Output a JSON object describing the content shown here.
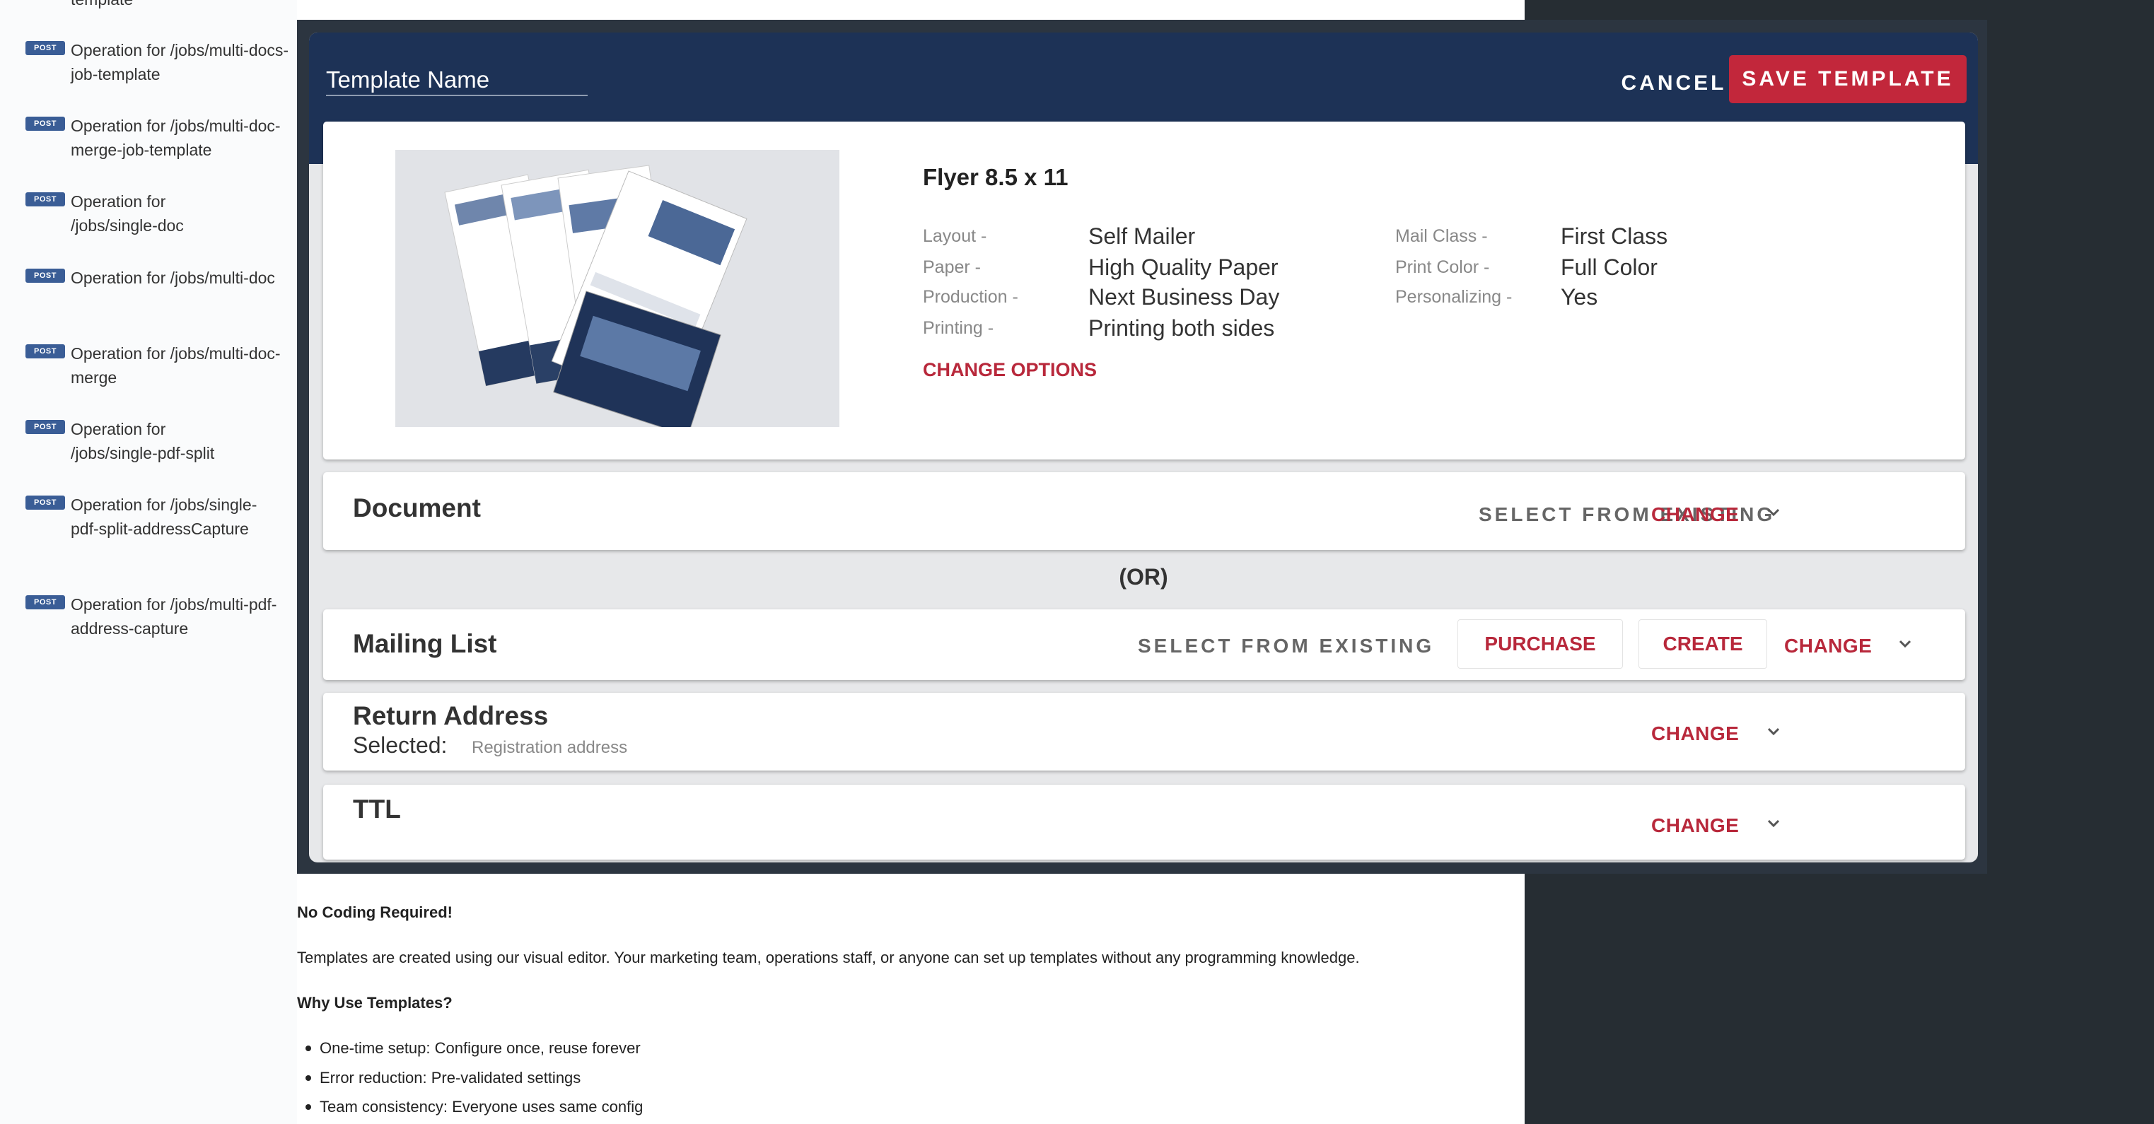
{
  "sidebar": {
    "cut_label": "template",
    "items": [
      {
        "badge": "POST",
        "label": "Operation for /jobs/multi-docs-job-template"
      },
      {
        "badge": "POST",
        "label": "Operation for /jobs/multi-doc-merge-job-template"
      },
      {
        "badge": "POST",
        "label": "Operation for /jobs/single-doc"
      },
      {
        "badge": "POST",
        "label": "Operation for /jobs/multi-doc"
      },
      {
        "badge": "POST",
        "label": "Operation for /jobs/multi-doc-merge"
      },
      {
        "badge": "POST",
        "label": "Operation for /jobs/single-pdf-split"
      },
      {
        "badge": "POST",
        "label": "Operation for /jobs/single-pdf-split-addressCapture"
      },
      {
        "badge": "POST",
        "label": "Operation for /jobs/multi-pdf-address-capture"
      }
    ]
  },
  "modal": {
    "template_name_placeholder": "Template Name",
    "cancel_label": "CANCEL",
    "save_label": "SAVE TEMPLATE",
    "product": {
      "title": "Flyer 8.5 x 11",
      "options_left": [
        {
          "label": "Layout -",
          "value": "Self Mailer"
        },
        {
          "label": "Paper -",
          "value": "High Quality Paper"
        },
        {
          "label": "Production -",
          "value": "Next Business Day"
        },
        {
          "label": "Printing -",
          "value": "Printing both sides"
        }
      ],
      "options_right": [
        {
          "label": "Mail Class -",
          "value": "First Class"
        },
        {
          "label": "Print Color -",
          "value": "Full Color"
        },
        {
          "label": "Personalizing -",
          "value": "Yes"
        }
      ],
      "change_options": "CHANGE OPTIONS"
    },
    "document": {
      "title": "Document",
      "select_existing": "SELECT FROM EXISTING",
      "change": "CHANGE"
    },
    "or_text": "(OR)",
    "mailing_list": {
      "title": "Mailing List",
      "select_existing": "SELECT FROM EXISTING",
      "purchase": "PURCHASE",
      "create": "CREATE",
      "change": "CHANGE"
    },
    "return_address": {
      "title": "Return Address",
      "selected_label": "Selected:",
      "selected_value": "Registration address",
      "change": "CHANGE"
    },
    "ttl": {
      "title": "TTL",
      "change": "CHANGE"
    }
  },
  "doc": {
    "no_coding_heading": "No Coding Required!",
    "no_coding_body": "Templates are created using our visual editor. Your marketing team, operations staff, or anyone can set up templates without any programming knowledge.",
    "why_heading": "Why Use Templates?",
    "bullets": [
      "One-time setup: Configure once, reuse forever",
      "Error reduction: Pre-validated settings",
      "Team consistency: Everyone uses same config"
    ]
  },
  "colors": {
    "header_navy": "#1d3256",
    "accent_red": "#b8283b",
    "save_button_red": "#c2273b",
    "post_badge": "#3a5d96",
    "dark_panel": "#262d33"
  },
  "icons": [
    "chevron-down-icon",
    "product-preview-image"
  ]
}
